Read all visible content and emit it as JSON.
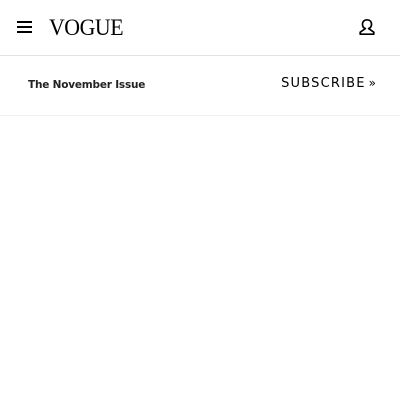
{
  "header": {
    "logo_text": "VOGUE",
    "menu_icon": "hamburger-menu-icon",
    "account_icon": "user-account-icon"
  },
  "promo": {
    "issue_label": "The November Issue",
    "subscribe_label": "SUBSCRIBE",
    "subscribe_chevron": "»"
  }
}
